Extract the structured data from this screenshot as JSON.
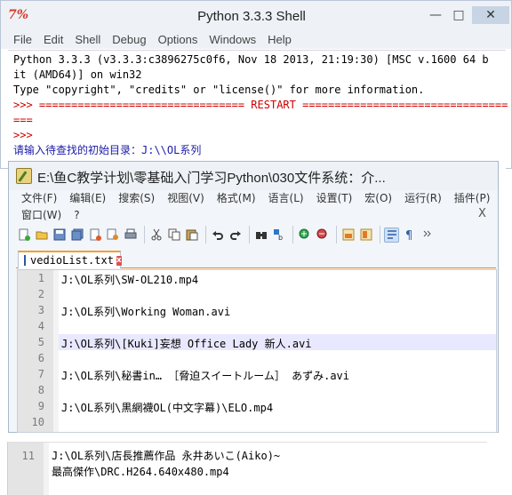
{
  "shell": {
    "title": "Python 3.3.3 Shell",
    "logo": "7%",
    "controls": {
      "minimize": "—",
      "maximize": "□",
      "close": "✕"
    },
    "menu": [
      "File",
      "Edit",
      "Shell",
      "Debug",
      "Options",
      "Windows",
      "Help"
    ],
    "lines": {
      "l1": "Python 3.3.3 (v3.3.3:c3896275c0f6, Nov 18 2013, 21:19:30) [MSC v.1600 64 b",
      "l2": "it (AMD64)] on win32",
      "l3": "Type \"copyright\", \"credits\" or \"license()\" for more information.",
      "l4": ">>> ================================ RESTART ================================",
      "l5": "===",
      "l6": ">>> ",
      "l7": "请输入待查找的初始目录：J:\\\\OL系列"
    }
  },
  "npp": {
    "title": "E:\\鱼C教学计划\\零基础入门学习Python\\030文件系统：介...",
    "menu_row1": [
      "文件(F)",
      "编辑(E)",
      "搜索(S)",
      "视图(V)",
      "格式(M)",
      "语言(L)",
      "设置(T)",
      "宏(O)",
      "运行(R)",
      "插件(P)"
    ],
    "menu_row2": [
      "窗口(W)",
      "?"
    ],
    "menu_close": "X",
    "toolbar_icons": [
      "new-file-icon",
      "open-file-icon",
      "save-icon",
      "save-all-icon",
      "close-icon",
      "close-all-icon",
      "print-icon",
      "cut-icon",
      "copy-icon",
      "paste-icon",
      "undo-icon",
      "redo-icon",
      "find-icon",
      "replace-icon",
      "zoom-in-icon",
      "zoom-out-icon",
      "sync-v-icon",
      "sync-h-icon",
      "word-wrap-icon",
      "show-all-chars-icon",
      "more-icon"
    ],
    "tab_label": "vedioList.txt",
    "lines": [
      {
        "n": "1",
        "text": "J:\\OL系列\\SW-OL210.mp4"
      },
      {
        "n": "2",
        "text": ""
      },
      {
        "n": "3",
        "text": "J:\\OL系列\\Working Woman.avi"
      },
      {
        "n": "4",
        "text": ""
      },
      {
        "n": "5",
        "text": "J:\\OL系列\\[Kuki]妄想 Office Lady 新人.avi"
      },
      {
        "n": "6",
        "text": ""
      },
      {
        "n": "7",
        "text": "J:\\OL系列\\秘書in… ［脅迫スイートルーム］ あずみ.avi"
      },
      {
        "n": "8",
        "text": ""
      },
      {
        "n": "9",
        "text": "J:\\OL系列\\黒網襪OL(中文字幕)\\ELO.mp4"
      },
      {
        "n": "10",
        "text": ""
      }
    ],
    "fragment": {
      "n": "11",
      "line1": "J:\\OL系列\\店長推薦作品 永井あいこ(Aiko)~",
      "line2": "最高傑作\\DRC.H264.640x480.mp4"
    }
  }
}
